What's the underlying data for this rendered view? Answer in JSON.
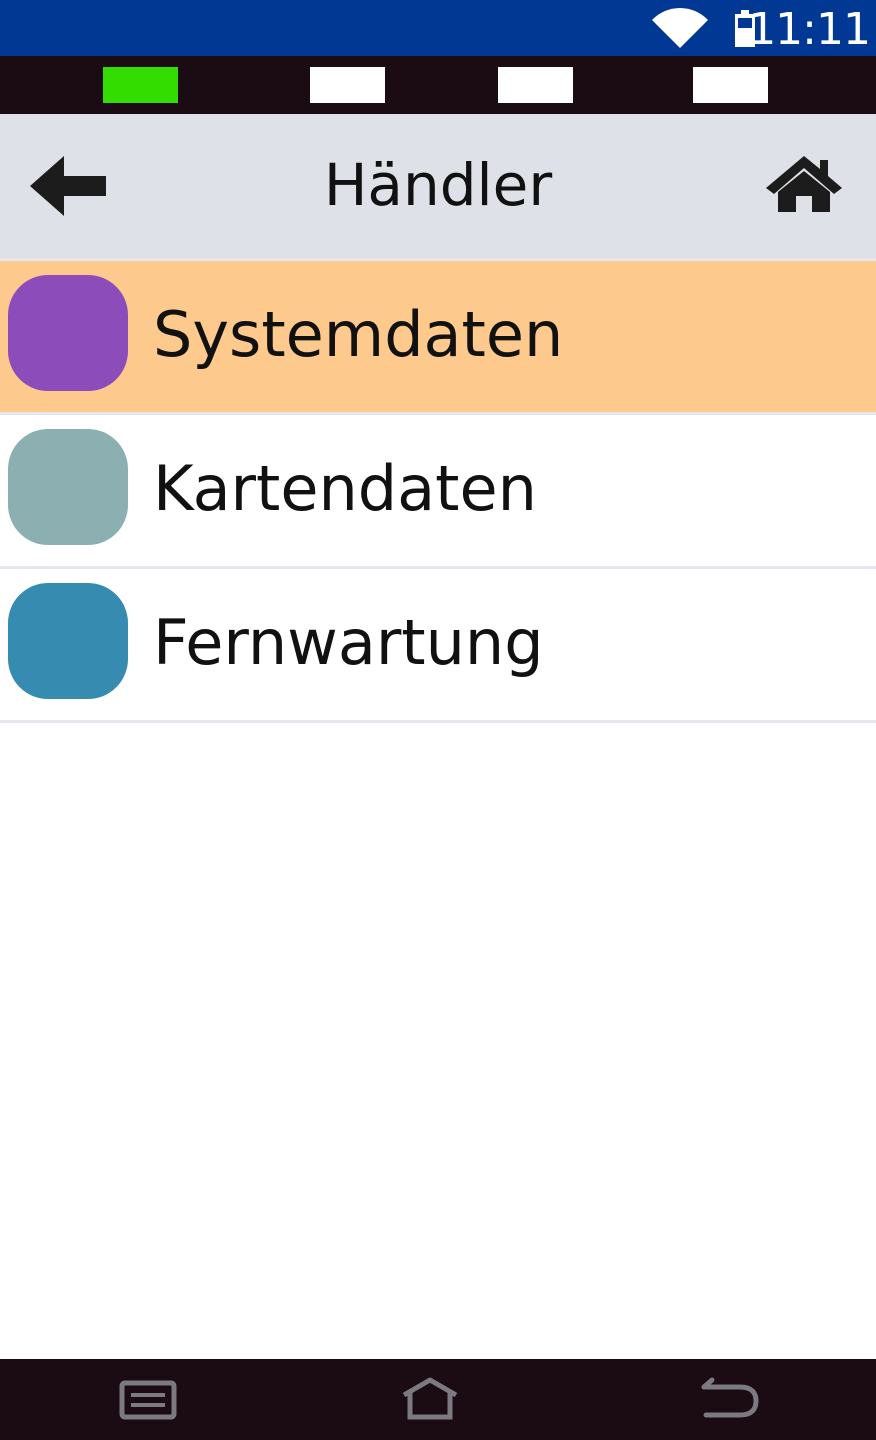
{
  "status_bar": {
    "time": "11:11",
    "wifi_icon": "wifi-icon",
    "battery_icon": "battery-icon",
    "background": "#003894"
  },
  "indicators": [
    {
      "state": "active",
      "color": "#33dd00"
    },
    {
      "state": "inactive",
      "color": "#ffffff"
    },
    {
      "state": "inactive",
      "color": "#ffffff"
    },
    {
      "state": "inactive",
      "color": "#ffffff"
    }
  ],
  "header": {
    "title": "Händler",
    "back_icon": "arrow-left-icon",
    "home_icon": "home-icon",
    "background": "#dee2e8"
  },
  "menu": {
    "items": [
      {
        "label": "Systemdaten",
        "swatch_color": "#8c4dbb",
        "selected": true,
        "highlight": "#fec98c"
      },
      {
        "label": "Kartendaten",
        "swatch_color": "#8cb0b1",
        "selected": false
      },
      {
        "label": "Fernwartung",
        "swatch_color": "#368cb0",
        "selected": false
      }
    ]
  },
  "nav_bar": {
    "recent_icon": "recent-apps-icon",
    "home_icon": "home-outline-icon",
    "back_icon": "back-icon"
  }
}
